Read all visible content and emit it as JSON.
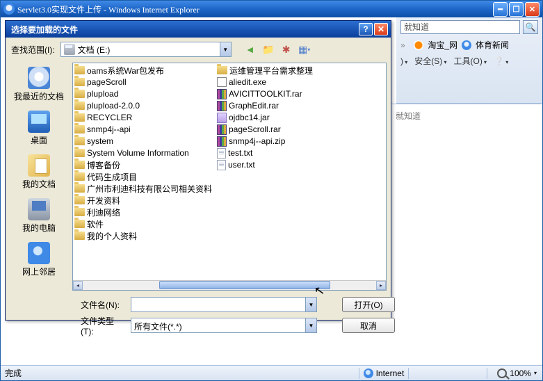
{
  "ie": {
    "title": "Servlet3.0实现文件上传 - Windows Internet Explorer",
    "sys": {
      "min": "━",
      "max": "❐",
      "close": "✕"
    },
    "search": {
      "placeholder": "就知道",
      "go": "🔍"
    },
    "links": {
      "taobao": "淘宝_网",
      "sport": "体育新闻"
    },
    "toolbar": {
      "safe": "安全(S)",
      "tools": "工具(O)",
      "help": "❔"
    }
  },
  "status": {
    "done": "完成",
    "net": "Internet",
    "zoom": "100%"
  },
  "dlg": {
    "title": "选择要加载的文件",
    "help": "?",
    "close": "✕",
    "lookin_label": "查找范围(I):",
    "lookin_value": "文档 (E:)",
    "tb": {
      "back": "◄",
      "up": "📁",
      "newf": "✱",
      "views": "▦",
      "dd": "▾"
    },
    "places": {
      "recent": "我最近的文档",
      "desktop": "桌面",
      "mydoc": "我的文档",
      "mycomp": "我的电脑",
      "neigh": "网上邻居"
    },
    "files_col1": [
      {
        "icon": "folder",
        "name": "oams系统War包发布"
      },
      {
        "icon": "folder",
        "name": "pageScroll"
      },
      {
        "icon": "folder",
        "name": "plupload"
      },
      {
        "icon": "folder",
        "name": "plupload-2.0.0"
      },
      {
        "icon": "folder",
        "name": "RECYCLER"
      },
      {
        "icon": "folder",
        "name": "snmp4j--api"
      },
      {
        "icon": "folder",
        "name": "system"
      },
      {
        "icon": "folder",
        "name": "System Volume Information"
      },
      {
        "icon": "folder",
        "name": "博客备份"
      },
      {
        "icon": "folder",
        "name": "代码生成项目"
      },
      {
        "icon": "folder",
        "name": "广州市利迪科技有限公司相关资料"
      },
      {
        "icon": "folder",
        "name": "开发资料"
      },
      {
        "icon": "folder",
        "name": "利迪网络"
      },
      {
        "icon": "folder",
        "name": "软件"
      },
      {
        "icon": "folder",
        "name": "我的个人资料"
      }
    ],
    "files_col2": [
      {
        "icon": "folder",
        "name": "运维管理平台需求整理"
      },
      {
        "icon": "exe",
        "name": "aliedit.exe"
      },
      {
        "icon": "rar",
        "name": "AVICITTOOLKIT.rar"
      },
      {
        "icon": "rar",
        "name": "GraphEdit.rar"
      },
      {
        "icon": "jar",
        "name": "ojdbc14.jar"
      },
      {
        "icon": "rar",
        "name": "pageScroll.rar"
      },
      {
        "icon": "rar",
        "name": "snmp4j--api.zip"
      },
      {
        "icon": "file",
        "name": "test.txt"
      },
      {
        "icon": "file",
        "name": "user.txt"
      }
    ],
    "filename_label": "文件名(N):",
    "filename_value": "",
    "filetype_label": "文件类型(T):",
    "filetype_value": "所有文件(*.*)",
    "open": "打开(O)",
    "cancel": "取消"
  },
  "bg_text": "就知道"
}
